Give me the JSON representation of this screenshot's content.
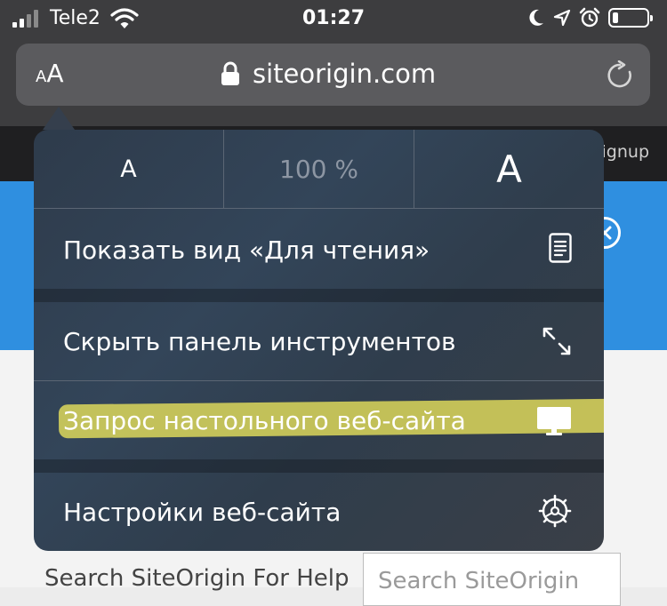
{
  "status_bar": {
    "carrier": "Tele2",
    "time": "01:27",
    "icons": [
      "signal-icon",
      "wifi-icon",
      "moon-icon",
      "location-icon",
      "alarm-icon",
      "battery-icon"
    ]
  },
  "address_bar": {
    "text_size_small": "A",
    "text_size_large": "A",
    "url": "siteorigin.com",
    "icons": [
      "lock-icon",
      "reload-icon"
    ]
  },
  "font_menu": {
    "decrease_label": "A",
    "zoom_level": "100 %",
    "increase_label": "A"
  },
  "menu_items": [
    {
      "label": "Показать вид «Для чтения»",
      "icon": "reader-view-icon"
    },
    {
      "label": "Скрыть панель инструментов",
      "icon": "expand-arrows-icon"
    },
    {
      "label": "Запрос настольного веб-сайта",
      "icon": "desktop-icon",
      "highlighted": true,
      "highlight_color": "#ece65c"
    },
    {
      "label": "Настройки веб-сайта",
      "icon": "gear-icon"
    }
  ],
  "page": {
    "signup_text": "ignup",
    "search_label": "Search SiteOrigin For Help",
    "search_placeholder": "Search SiteOrigin"
  },
  "colors": {
    "hero_blue": "#2f8fe0",
    "popover_bg": "#2f3d4c"
  }
}
